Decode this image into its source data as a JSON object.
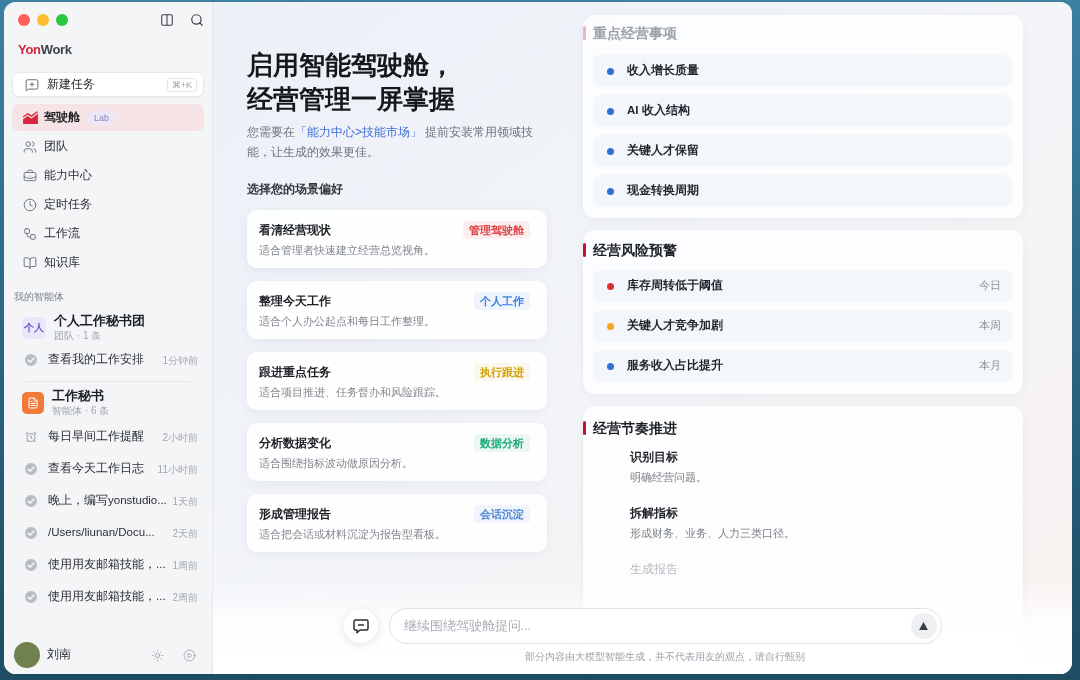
{
  "window": {
    "logo_first": "Yon",
    "logo_second": "Work"
  },
  "sidebar": {
    "new_task": {
      "label": "新建任务",
      "shortcut": "⌘+K"
    },
    "nav": [
      {
        "label": "驾驶舱",
        "badge": "Lab",
        "selected": true
      },
      {
        "label": "团队",
        "selected": false
      },
      {
        "label": "能力中心",
        "selected": false
      },
      {
        "label": "定时任务",
        "selected": false
      },
      {
        "label": "工作流",
        "selected": false
      },
      {
        "label": "知识库",
        "selected": false
      }
    ],
    "agents_heading": "我的智能体",
    "groups": [
      {
        "kind": "team",
        "avatar_text": "个人",
        "title": "个人工作秘书团",
        "subtitle": "团队 · 1 条",
        "items": [
          {
            "kind": "task",
            "label": "查看我的工作安排",
            "time": "1分钟前"
          }
        ]
      },
      {
        "kind": "agent",
        "title": "工作秘书",
        "subtitle": "智能体 · 6 条",
        "items": [
          {
            "kind": "reminder",
            "label": "每日早间工作提醒",
            "time": "2小时前"
          },
          {
            "kind": "task",
            "label": "查看今天工作日志",
            "time": "11小时前"
          },
          {
            "kind": "task",
            "label": "晚上，编写yonstudio...",
            "time": "1天前"
          },
          {
            "kind": "task",
            "label": "/Users/liunan/Docu...",
            "time": "2天前"
          },
          {
            "kind": "task",
            "label": "使用用友邮箱技能，...",
            "time": "1周前"
          },
          {
            "kind": "task",
            "label": "使用用友邮箱技能，...",
            "time": "2周前"
          }
        ]
      }
    ],
    "user": {
      "name": "刘南"
    }
  },
  "main": {
    "heading": [
      "启用智能驾驶舱，",
      "经营管理一屏掌握"
    ],
    "intro": {
      "before": "您需要在",
      "link": "「能力中心>技能市场」",
      "after": " 提前安装常用领域技能，让生成的效果更佳。"
    },
    "scenes_heading": "选择您的场景偏好",
    "scenes": [
      {
        "title": "看清经营现状",
        "description": "适合管理者快速建立经营总览视角。",
        "tag": "管理驾驶舱",
        "color": "#e0454a"
      },
      {
        "title": "整理今天工作",
        "description": "适合个人办公起点和每日工作整理。",
        "tag": "个人工作",
        "color": "#3a7fe0"
      },
      {
        "title": "跟进重点任务",
        "description": "适合项目推进、任务督办和风险跟踪。",
        "tag": "执行跟进",
        "color": "#d4a106"
      },
      {
        "title": "分析数据变化",
        "description": "适合围绕指标波动做原因分析。",
        "tag": "数据分析",
        "color": "#1ea97c"
      },
      {
        "title": "形成管理报告",
        "description": "适合把会话或材料沉淀为报告型看板。",
        "tag": "会话沉淀",
        "color": "#4a86d4"
      }
    ]
  },
  "panels": [
    {
      "kind": "list",
      "title": "重点经营事项",
      "dimmed": true,
      "items": [
        {
          "label": "收入增长质量",
          "color": "#2f6fd6"
        },
        {
          "label": "AI 收入结构",
          "color": "#2f6fd6"
        },
        {
          "label": "关键人才保留",
          "color": "#2f6fd6"
        },
        {
          "label": "现金转换周期",
          "color": "#2f6fd6"
        }
      ]
    },
    {
      "kind": "list",
      "title": "经营风险预警",
      "dimmed": false,
      "items": [
        {
          "label": "库存周转低于阈值",
          "when": "今日",
          "color": "#d63031"
        },
        {
          "label": "关键人才竞争加剧",
          "when": "本周",
          "color": "#f0a520"
        },
        {
          "label": "服务收入占比提升",
          "when": "本月",
          "color": "#2f6fd6"
        }
      ]
    },
    {
      "kind": "steps",
      "title": "经营节奏推进",
      "dimmed": false,
      "steps": [
        {
          "title": "识别目标",
          "description": "明确经营问题。",
          "dimmed": false
        },
        {
          "title": "拆解指标",
          "description": "形成财务、业务、人力三类口径。",
          "dimmed": false
        },
        {
          "title": "生成报告",
          "dimmed": true
        }
      ]
    }
  ],
  "composer": {
    "placeholder": "继续围绕驾驶舱提问...",
    "disclaimer": "部分内容由大模型智能生成，并不代表用友的观点，请自行甄别"
  }
}
